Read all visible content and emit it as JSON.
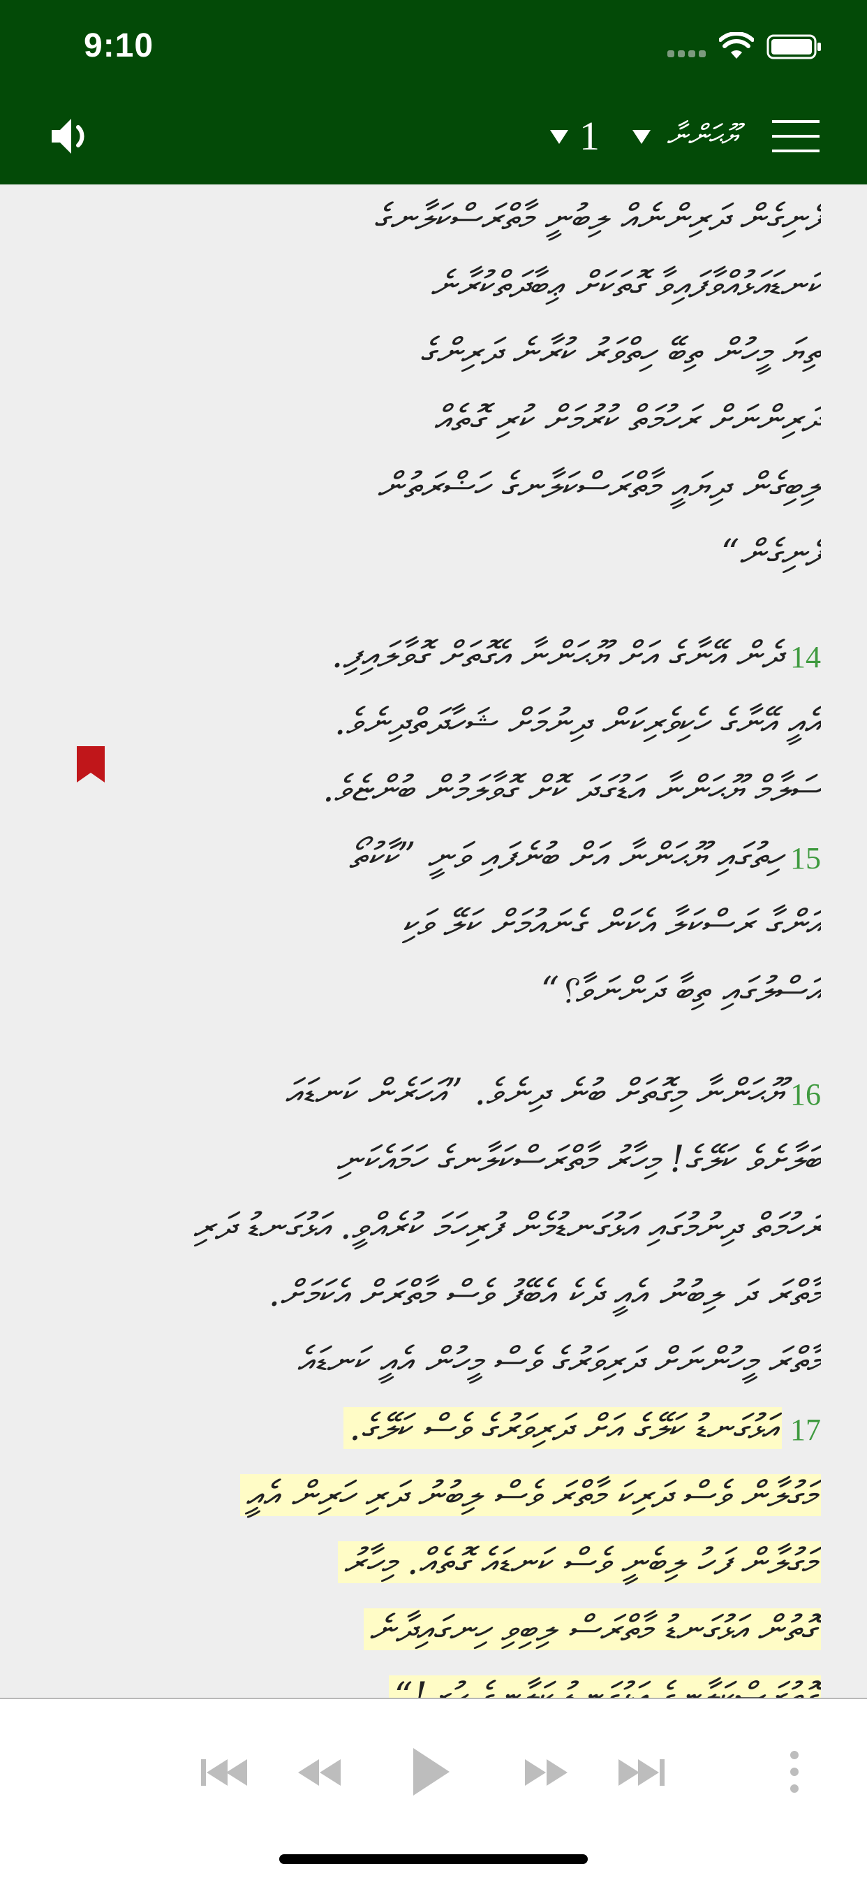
{
  "status_bar": {
    "time": "9:10"
  },
  "header": {
    "chapter_number": "1",
    "book_name": "ޔޫޙަންނާ",
    "bg_color": "#034a07"
  },
  "icons": {
    "audio": "speaker-icon",
    "chapter_selector": "triangle-down-icon",
    "book_selector": "triangle-down-icon",
    "menu": "hamburger-menu-icon",
    "bookmark": "bookmark-icon",
    "player": [
      "skip-previous-icon",
      "rewind-icon",
      "play-icon",
      "fast-forward-icon",
      "skip-next-icon",
      "more-vertical-icon"
    ]
  },
  "text_lines": [
    {
      "text": "ފެނިގެން ދަރިންނެއް ލިބުނީ މާތްރަސްކަލާނގެ",
      "verse": "",
      "hl": false
    },
    {
      "text": "ކަނޑައަޅުއްވާފައިވާ ގޮތަކަށް ޢިބާދަތްކުރާނެ",
      "verse": "",
      "hl": false
    },
    {
      "text": "ތިޔަ މީހުން ތިބޭ ހިތްވަރު ކުރާނެ ދަރިންގެ",
      "verse": "",
      "hl": false
    },
    {
      "text": "ދަރިންނަށް ރަހުމަތް ކުރުމަށް ކުރި ގޮތެއް",
      "verse": "",
      "hl": false
    },
    {
      "text": "ލިބިގެން ދިޔައީ މާތްރަސްކަލާނގެ ހަޟްރަތުން",
      "verse": "",
      "hl": false
    },
    {
      "text": "ފެނިގެން“",
      "verse": "",
      "hl": false
    },
    {
      "text": "ދެން އޭނާގެ އަށް ޔޫޙަންނާ އެގޮތަށް ގޮވާލައިފި.",
      "verse": "14",
      "hl": false
    },
    {
      "text": "އެއީ އޭނާގެ ހެކިވެރިކަން ދިނުމަށް ޝަހާދަތްދިނެވެ.",
      "verse": "",
      "hl": false
    },
    {
      "text": "ސަލާމް ޔޫޙަންނާ އަޑުގަދަ ކޮށް ގޮވާލަމުން ބުންޏެވެ.",
      "verse": "",
      "hl": false
    },
    {
      "text": "ހިތުގައި ޔޫޙަންނާ އަށް ބުނެފައި ވަނީ ”ކާކުތޯ",
      "verse": "15",
      "hl": false
    },
    {
      "text": "އަންގާ ރަސްކަލާ އެކަން ގެނައުމަށް ކަލޭ ވަކި",
      "verse": "",
      "hl": false
    },
    {
      "text": "އަސްލުގައި ތިބާ ދަންނަވާ؟“",
      "verse": "",
      "hl": false
    },
    {
      "text": "ޔޫޙަންނާ މިގޮތަށް ބުނެ ދިނެވެ. ”އަހަރެން ކަނޑައަ",
      "verse": "16",
      "hl": false
    },
    {
      "text": "ބަލާށެވެ ކަލޭގެ! މިހާރު މާތްރަސްކަލާނގެ ހަމައެކަނި",
      "verse": "",
      "hl": false
    },
    {
      "text": "ރަހުމަތް ދިނުމުގައި އަޅުގަނޑުމެން ފުރިހަމަ ކުރެއްވީ. އަޅުގަނޑު ދަރި",
      "verse": "",
      "hl": false
    },
    {
      "text": "މާތްރަ ދަ ލިބުނު އެއީ ދެކެ އެބޭފު ވެސް މާތްރަށް އެކަމަށް.",
      "verse": "",
      "hl": false
    },
    {
      "text": "މާތްރަ މީހުންނަށް ދަރިވަރުގެ ވެސް މީހުން އެއީ ކަނޑައެ",
      "verse": "",
      "hl": false
    },
    {
      "text": "ކަލޭގެ އަށް ދަރިވަރުގެ ވެސް ކަލޭގެ.",
      "verse": "17",
      "hl": true,
      "hl_tail": "އަޅުގަނޑު"
    },
    {
      "text": "މަގުލާން ވެސް ދަރިކަ މާތްރަ ވެސް ލިބުނު ދަރި ހަރިން އެއީ",
      "verse": "",
      "hl": true
    },
    {
      "text": "މަގުލާން ފަހު ލިބެނީ ވެސް ކަނޑައެ ގޮތެއް. މިހާރު",
      "verse": "",
      "hl": true
    },
    {
      "text": "ގޮތުން އަޅުގަނޑު މާތްރަސް ލިބިވި ހިނގައިދާނެ",
      "verse": "",
      "hl": true
    },
    {
      "text": "ގޮތުރަސްކަލާނގެ އަޅުގަނޑު ކަލާނގެ ހުރި!“",
      "verse": "",
      "hl": true
    }
  ]
}
